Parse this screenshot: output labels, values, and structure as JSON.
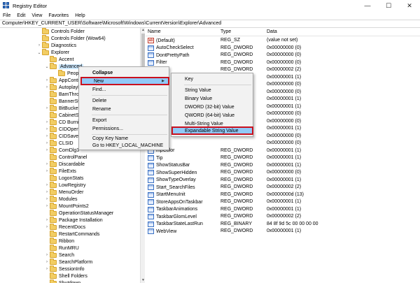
{
  "window": {
    "title": "Registry Editor",
    "minimize": "—",
    "maximize": "☐",
    "close": "✕"
  },
  "menu": [
    "File",
    "Edit",
    "View",
    "Favorites",
    "Help"
  ],
  "address": "Computer\\HKEY_CURRENT_USER\\Software\\Microsoft\\Windows\\CurrentVersion\\Explorer\\Advanced",
  "tree": [
    {
      "label": "Controls Folder",
      "indent": 2,
      "expander": ""
    },
    {
      "label": "Controls Folder (Wow64)",
      "indent": 2,
      "expander": ""
    },
    {
      "label": "Diagnostics",
      "indent": 2,
      "expander": ">"
    },
    {
      "label": "Explorer",
      "indent": 2,
      "expander": "v"
    },
    {
      "label": "Accent",
      "indent": 3,
      "expander": ""
    },
    {
      "label": "Advanced",
      "indent": 3,
      "expander": "v",
      "selected": true
    },
    {
      "label": "People",
      "indent": 4,
      "expander": ""
    },
    {
      "label": "AppContr",
      "indent": 3,
      "expander": ">"
    },
    {
      "label": "Autoplayl",
      "indent": 3,
      "expander": ">"
    },
    {
      "label": "BamThro",
      "indent": 3,
      "expander": ""
    },
    {
      "label": "BannerSto",
      "indent": 3,
      "expander": ""
    },
    {
      "label": "BitBucket",
      "indent": 3,
      "expander": ">"
    },
    {
      "label": "CabinetSt",
      "indent": 3,
      "expander": ""
    },
    {
      "label": "CD Burnin",
      "indent": 3,
      "expander": ">"
    },
    {
      "label": "CIDOpen",
      "indent": 3,
      "expander": ">"
    },
    {
      "label": "CIDSave",
      "indent": 3,
      "expander": ">"
    },
    {
      "label": "CLSID",
      "indent": 3,
      "expander": ">"
    },
    {
      "label": "ComDlg3",
      "indent": 3,
      "expander": ">"
    },
    {
      "label": "ControlPanel",
      "indent": 3,
      "expander": ""
    },
    {
      "label": "Discardable",
      "indent": 3,
      "expander": ">"
    },
    {
      "label": "FileExts",
      "indent": 3,
      "expander": ">"
    },
    {
      "label": "LogonStats",
      "indent": 3,
      "expander": ""
    },
    {
      "label": "LowRegistry",
      "indent": 3,
      "expander": ">"
    },
    {
      "label": "MenuOrder",
      "indent": 3,
      "expander": ">"
    },
    {
      "label": "Modules",
      "indent": 3,
      "expander": ">"
    },
    {
      "label": "MountPoints2",
      "indent": 3,
      "expander": ">"
    },
    {
      "label": "OperationStatusManager",
      "indent": 3,
      "expander": ""
    },
    {
      "label": "Package Installation",
      "indent": 3,
      "expander": ">"
    },
    {
      "label": "RecentDocs",
      "indent": 3,
      "expander": ">"
    },
    {
      "label": "RestartCommands",
      "indent": 3,
      "expander": ""
    },
    {
      "label": "Ribbon",
      "indent": 3,
      "expander": ""
    },
    {
      "label": "RunMRU",
      "indent": 3,
      "expander": ""
    },
    {
      "label": "Search",
      "indent": 3,
      "expander": ">"
    },
    {
      "label": "SearchPlatform",
      "indent": 3,
      "expander": ">"
    },
    {
      "label": "SessionInfo",
      "indent": 3,
      "expander": ">"
    },
    {
      "label": "Shell Folders",
      "indent": 3,
      "expander": ""
    },
    {
      "label": "Shutdown",
      "indent": 3,
      "expander": ""
    }
  ],
  "columns": {
    "name": "Name",
    "type": "Type",
    "data": "Data"
  },
  "values": [
    {
      "name": "(Default)",
      "type": "REG_SZ",
      "data": "(value not set)",
      "icon": "string"
    },
    {
      "name": "AutoCheckSelect",
      "type": "REG_DWORD",
      "data": "0x00000000 (0)",
      "icon": "binary"
    },
    {
      "name": "DontPrettyPath",
      "type": "REG_DWORD",
      "data": "0x00000000 (0)",
      "icon": "binary"
    },
    {
      "name": "Filter",
      "type": "REG_DWORD",
      "data": "0x00000000 (0)",
      "icon": "binary"
    },
    {
      "name": "",
      "type": "REG_DWORD",
      "data": "0x00000002 (2)",
      "icon": "binary"
    },
    {
      "name": "",
      "type": "",
      "data": "0x00000001 (1)",
      "icon": "binary"
    },
    {
      "name": "",
      "type": "",
      "data": "0x00000000 (0)",
      "icon": "binary"
    },
    {
      "name": "",
      "type": "",
      "data": "0x00000000 (0)",
      "icon": "binary"
    },
    {
      "name": "",
      "type": "",
      "data": "0x00000001 (1)",
      "icon": "binary"
    },
    {
      "name": "",
      "type": "",
      "data": "0x00000001 (1)",
      "icon": "binary"
    },
    {
      "name": "",
      "type": "",
      "data": "0x00000000 (0)",
      "icon": "binary"
    },
    {
      "name": "",
      "type": "",
      "data": "0x00000000 (0)",
      "icon": "binary"
    },
    {
      "name": "",
      "type": "",
      "data": "0x00000001 (1)",
      "icon": "binary"
    },
    {
      "name": "",
      "type": "",
      "data": "0x00000000 (0)",
      "icon": "binary"
    },
    {
      "name": "",
      "type": "",
      "data": "0x00000000 (0)",
      "icon": "binary"
    },
    {
      "name": "ShowCompColor",
      "type": "REG_DWORD",
      "data": "0x00000001 (1)",
      "icon": "binary",
      "visibleName": "mpColor"
    },
    {
      "name": "ShowInfoTip",
      "type": "REG_DWORD",
      "data": "0x00000001 (1)",
      "icon": "binary",
      "visibleName": "Tip"
    },
    {
      "name": "ShowStatusBar",
      "type": "REG_DWORD",
      "data": "0x00000001 (1)",
      "icon": "binary"
    },
    {
      "name": "ShowSuperHidden",
      "type": "REG_DWORD",
      "data": "0x00000000 (0)",
      "icon": "binary"
    },
    {
      "name": "ShowTypeOverlay",
      "type": "REG_DWORD",
      "data": "0x00000001 (1)",
      "icon": "binary"
    },
    {
      "name": "Start_SearchFiles",
      "type": "REG_DWORD",
      "data": "0x00000002 (2)",
      "icon": "binary"
    },
    {
      "name": "StartMenuInit",
      "type": "REG_DWORD",
      "data": "0x0000000d (13)",
      "icon": "binary"
    },
    {
      "name": "StoreAppsOnTaskbar",
      "type": "REG_DWORD",
      "data": "0x00000001 (1)",
      "icon": "binary"
    },
    {
      "name": "TaskbarAnimations",
      "type": "REG_DWORD",
      "data": "0x00000001 (1)",
      "icon": "binary"
    },
    {
      "name": "TaskbarGlomLevel",
      "type": "REG_DWORD",
      "data": "0x00000002 (2)",
      "icon": "binary"
    },
    {
      "name": "TaskbarStateLastRun",
      "type": "REG_BINARY",
      "data": "84 8f 9d 5c 00 00 00 00",
      "icon": "binary"
    },
    {
      "name": "WebView",
      "type": "REG_DWORD",
      "data": "0x00000001 (1)",
      "icon": "binary"
    }
  ],
  "context_menu": {
    "collapse": "Collapse",
    "new": "New",
    "find": "Find...",
    "delete": "Delete",
    "rename": "Rename",
    "export": "Export",
    "permissions": "Permissions...",
    "copy_key_name": "Copy Key Name",
    "goto": "Go to HKEY_LOCAL_MACHINE"
  },
  "submenu": {
    "key": "Key",
    "string": "String Value",
    "binary": "Binary Value",
    "dword": "DWORD (32-bit) Value",
    "qword": "QWORD (64-bit) Value",
    "multi": "Multi-String Value",
    "expandable": "Expandable String Value"
  },
  "colors": {
    "highlight_border": "#c9101e",
    "hover_fill": "#91c9f7",
    "selection": "#cce8ff",
    "folder": "#f2cd63"
  }
}
